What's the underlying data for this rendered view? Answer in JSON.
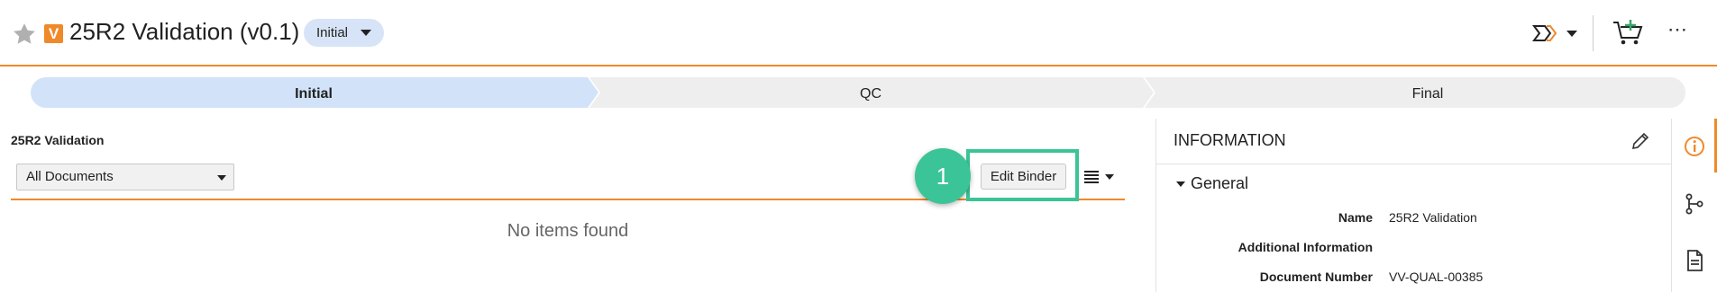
{
  "header": {
    "title": "25R2 Validation (v0.1)",
    "badge_letter": "V",
    "state_label": "Initial",
    "more_glyph": "⋯"
  },
  "lifecycle": {
    "stages": [
      "Initial",
      "QC",
      "Final"
    ],
    "current_index": 0
  },
  "binder": {
    "name": "25R2 Validation",
    "filter_value": "All Documents",
    "edit_button_label": "Edit Binder",
    "empty_message": "No items found",
    "marker_number": "1"
  },
  "info": {
    "title": "INFORMATION",
    "section_label": "General",
    "fields": [
      {
        "label": "Name",
        "value": "25R2 Validation"
      },
      {
        "label": "Additional Information",
        "value": ""
      },
      {
        "label": "Document Number",
        "value": "VV-QUAL-00385"
      }
    ]
  },
  "colors": {
    "accent_orange": "#f0892a",
    "highlight_green": "#3bc497",
    "current_stage": "#d2e3f9",
    "stage_grey": "#eeeeee"
  },
  "icons": {
    "header": [
      "star-icon",
      "workflow-icon",
      "cart-add-icon",
      "more-icon"
    ],
    "rail": [
      "info-icon",
      "relationships-icon",
      "document-icon"
    ]
  }
}
